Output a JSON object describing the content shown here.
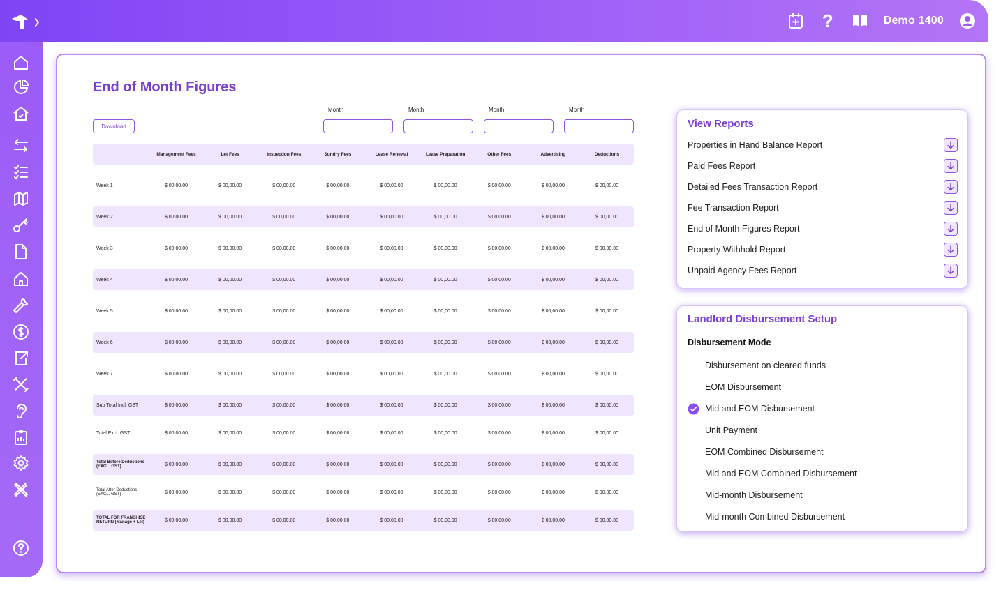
{
  "topbar": {
    "user_name": "Demo 1400",
    "help_symbol": "?",
    "icons": [
      "calendar-add-icon",
      "help-icon",
      "book-icon",
      "user-avatar-icon"
    ]
  },
  "sidebar": {
    "icons": [
      "home-icon",
      "pie-chart-icon",
      "house-check-icon",
      "transfer-icon",
      "checklist-icon",
      "map-icon",
      "key-icon",
      "document-icon",
      "house-icon",
      "wrench-icon",
      "dollar-icon",
      "export-icon",
      "tools-icon",
      "hearing-icon",
      "clipboard-icon",
      "settings-icon",
      "maintenance-icon",
      "help-circle-icon"
    ]
  },
  "main": {
    "title": "End of Month Figures",
    "download_label": "Download",
    "month_filters": [
      {
        "label": "Month",
        "value": ""
      },
      {
        "label": "Month",
        "value": ""
      },
      {
        "label": "Month",
        "value": ""
      },
      {
        "label": "Month",
        "value": ""
      }
    ],
    "table": {
      "headers": [
        "Management Fees",
        "Let Fees",
        "Inspection Fees",
        "Sundry Fees",
        "Lease Renewal",
        "Lease Preparation",
        "Other Fees",
        "Advertising",
        "Deductions"
      ],
      "rows": [
        {
          "label": "Week 1",
          "values": [
            "$ 00,00.00",
            "$ 00,00.00",
            "$ 00,00.00",
            "$ 00,00.00",
            "$ 00,00.00",
            "$ 00,00.00",
            "$ 00,00.00",
            "$ 00,00.00",
            "$ 00,00.00"
          ]
        },
        {
          "label": "Week 2",
          "values": [
            "$ 00,00.00",
            "$ 00,00.00",
            "$ 00,00.00",
            "$ 00,00.00",
            "$ 00,00.00",
            "$ 00,00.00",
            "$ 00,00.00",
            "$ 00,00.00",
            "$ 00,00.00"
          ]
        },
        {
          "label": "Week 3",
          "values": [
            "$ 00,00.00",
            "$ 00,00.00",
            "$ 00,00.00",
            "$ 00,00.00",
            "$ 00,00.00",
            "$ 00,00.00",
            "$ 00,00.00",
            "$ 00,00.00",
            "$ 00,00.00"
          ]
        },
        {
          "label": "Week 4",
          "values": [
            "$ 00,00.00",
            "$ 00,00.00",
            "$ 00,00.00",
            "$ 00,00.00",
            "$ 00,00.00",
            "$ 00,00.00",
            "$ 00,00.00",
            "$ 00,00.00",
            "$ 00,00.00"
          ]
        },
        {
          "label": "Week 5",
          "values": [
            "$ 00,00.00",
            "$ 00,00.00",
            "$ 00,00.00",
            "$ 00,00.00",
            "$ 00,00.00",
            "$ 00,00.00",
            "$ 00,00.00",
            "$ 00,00.00",
            "$ 00,00.00"
          ]
        },
        {
          "label": "Week 6",
          "values": [
            "$ 00,00.00",
            "$ 00,00.00",
            "$ 00,00.00",
            "$ 00,00.00",
            "$ 00,00.00",
            "$ 00,00.00",
            "$ 00,00.00",
            "$ 00,00.00",
            "$ 00,00.00"
          ]
        },
        {
          "label": "Week 7",
          "values": [
            "$ 00,00.00",
            "$ 00,00.00",
            "$ 00,00.00",
            "$ 00,00.00",
            "$ 00,00.00",
            "$ 00,00.00",
            "$ 00,00.00",
            "$ 00,00.00",
            "$ 00,00.00"
          ]
        },
        {
          "label": "Sub Total Incl. GST",
          "values": [
            "$ 00,00.00",
            "$ 00,00.00",
            "$ 00,00.00",
            "$ 00,00.00",
            "$ 00,00.00",
            "$ 00,00.00",
            "$ 00,00.00",
            "$ 00,00.00",
            "$ 00,00.00"
          ]
        },
        {
          "label": "Total Excl. GST",
          "values": [
            "$ 00,00.00",
            "$ 00,00.00",
            "$ 00,00.00",
            "$ 00,00.00",
            "$ 00,00.00",
            "$ 00,00.00",
            "$ 00,00.00",
            "$ 00,00.00",
            "$ 00,00.00"
          ]
        },
        {
          "label": "Total Before Deductions (EXCL. GST)",
          "values": [
            "$ 00,00.00",
            "$ 00,00.00",
            "$ 00,00.00",
            "$ 00,00.00",
            "$ 00,00.00",
            "$ 00,00.00",
            "$ 00,00.00",
            "$ 00,00.00",
            "$ 00,00.00"
          ]
        },
        {
          "label": "Total After Deductions (EXCL. GST)",
          "values": [
            "$ 00,00.00",
            "$ 00,00.00",
            "$ 00,00.00",
            "$ 00,00.00",
            "$ 00,00.00",
            "$ 00,00.00",
            "$ 00,00.00",
            "$ 00,00.00",
            "$ 00,00.00"
          ]
        },
        {
          "label": "TOTAL FOR FRANCHISE RETURN (Manage + Let)",
          "values": [
            "$ 00,00.00",
            "$ 00,00.00",
            "$ 00,00.00",
            "$ 00,00.00",
            "$ 00,00.00",
            "$ 00,00.00",
            "$ 00,00.00",
            "$ 00,00.00",
            "$ 00,00.00"
          ]
        }
      ]
    }
  },
  "reports": {
    "title": "View Reports",
    "items": [
      "Properties in Hand Balance Report",
      "Paid Fees Report",
      "Detailed Fees Transaction Report",
      "Fee Transaction Report",
      "End of Month Figures Report",
      "Property Withhold Report",
      "Unpaid Agency Fees Report"
    ]
  },
  "disbursement": {
    "title": "Landlord Disbursement Setup",
    "mode_heading": "Disbursement Mode",
    "selected": "Mid and EOM Disbursement",
    "options": [
      "Disbursement on cleared funds",
      "EOM Disbursement",
      "Mid and EOM Disbursement",
      "Unit Payment",
      "EOM Combined Disbursement",
      "Mid and EOM Combined Disbursement",
      "Mid-month Disbursement",
      "Mid-month Combined Disbursement"
    ]
  },
  "colors": {
    "accent": "#7a3fd1",
    "bar_start": "#7f45f5",
    "bar_end": "#b374f6",
    "row_shade": "#efe6fd"
  }
}
